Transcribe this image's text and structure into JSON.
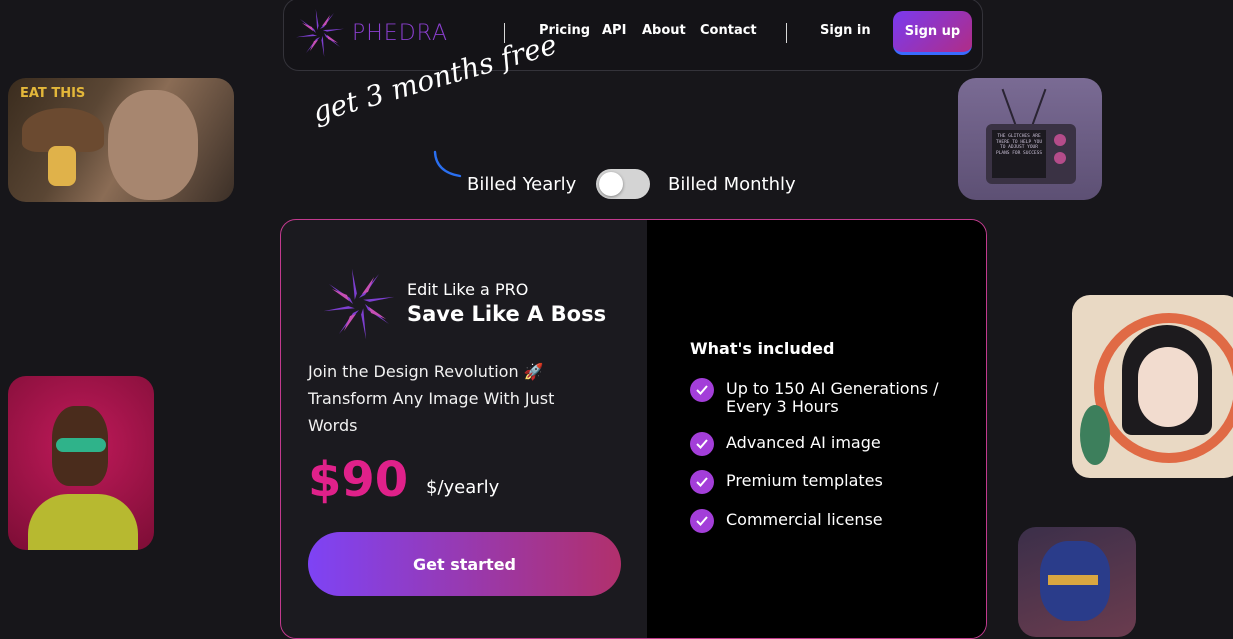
{
  "brand": {
    "name": "PHEDRA",
    "accent": "#8b3fcf"
  },
  "nav": {
    "links": [
      "Pricing",
      "API",
      "About",
      "Contact"
    ],
    "signin": "Sign in",
    "signup": "Sign up"
  },
  "thumbs": {
    "mushroom_text": "EAT THIS",
    "tv_text": "THE GLITCHES ARE THERE TO HELP YOU TO ADJUST YOUR PLANS FOR SUCCESS"
  },
  "promo": "get 3 months free",
  "billing": {
    "yearly": "Billed Yearly",
    "monthly": "Billed Monthly",
    "toggle_state": "yearly"
  },
  "plan": {
    "tagline": "Edit Like a PRO",
    "headline": "Save Like A Boss",
    "description": "Join the Design Revolution 🚀 Transform Any Image With Just Words",
    "price": "$90",
    "period": "$/yearly",
    "cta": "Get started",
    "included_title": "What's included",
    "features": [
      "Up to 150 AI Generations / Every 3 Hours",
      "Advanced AI image",
      "Premium templates",
      "Commercial license"
    ]
  },
  "colors": {
    "price": "#e0218a",
    "check": "#a33ed9",
    "cta_from": "#7e43f5",
    "cta_to": "#b1306c",
    "card_border": "#c23a8e"
  }
}
